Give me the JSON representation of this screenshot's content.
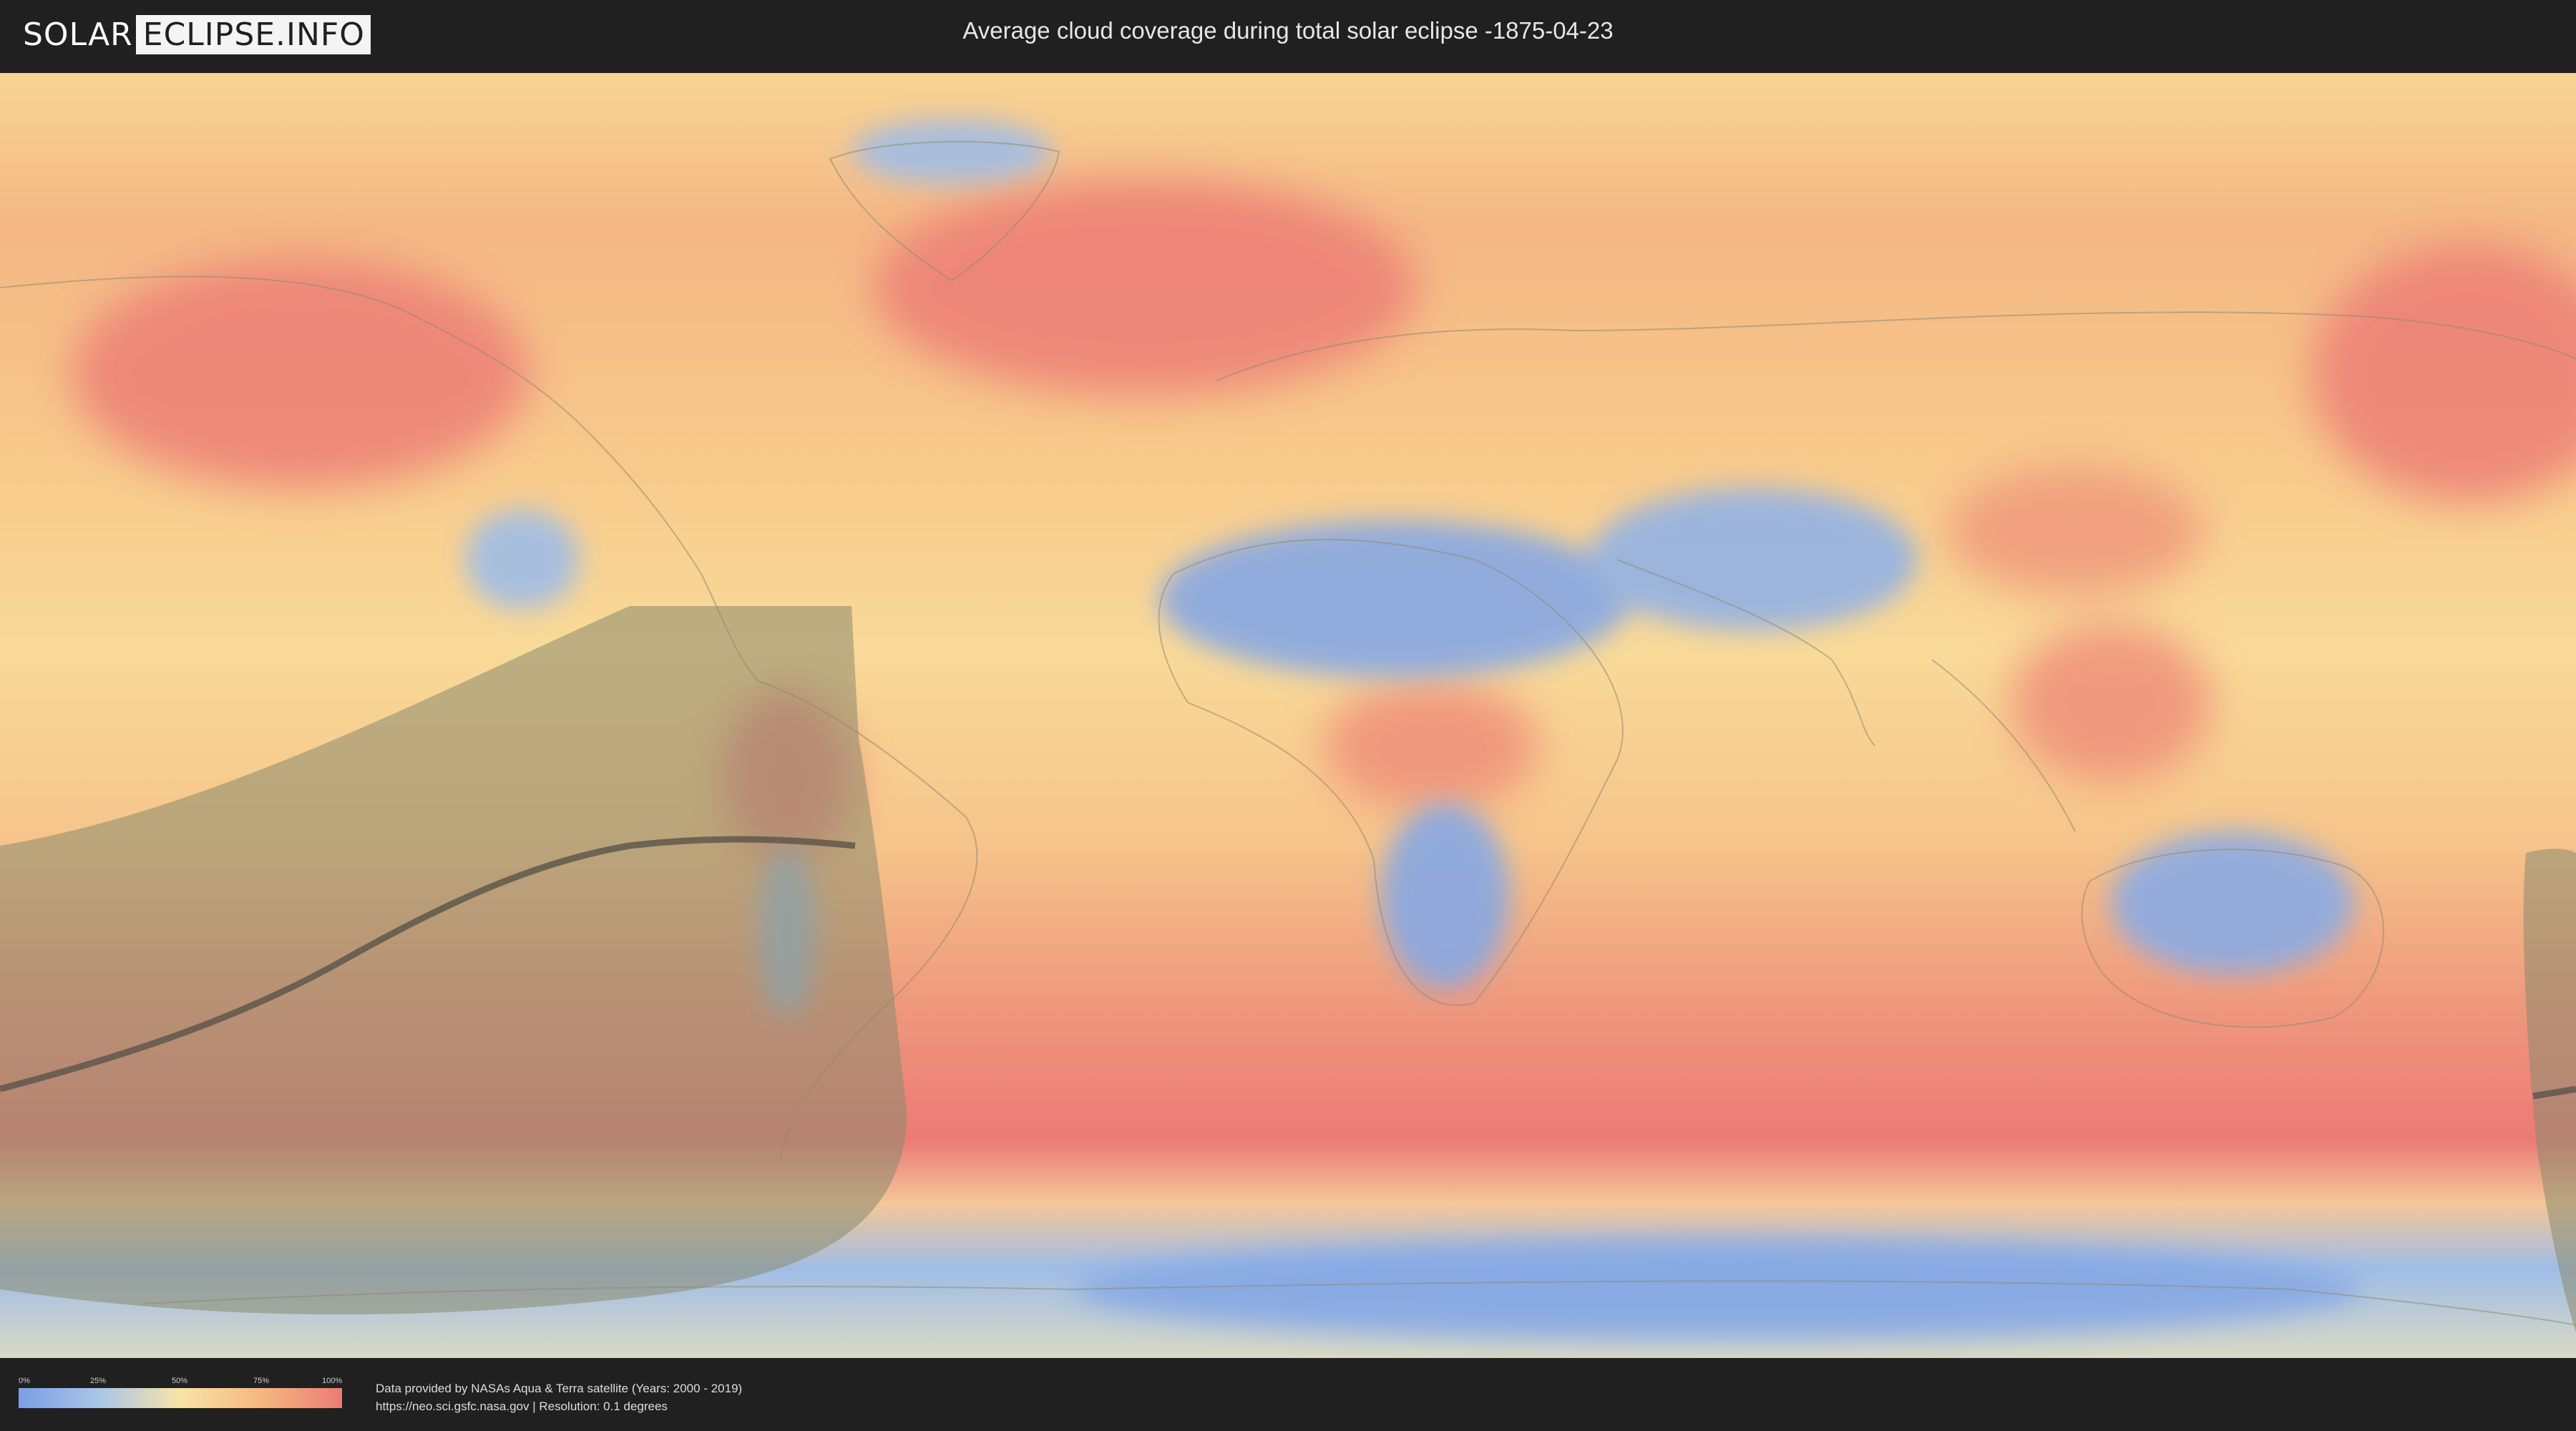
{
  "header": {
    "logo_solar": "SOLAR",
    "logo_eclipse": "ECLIPSE.INFO",
    "title": "Average cloud coverage during total solar eclipse -1875-04-23"
  },
  "legend": {
    "ticks": [
      "0%",
      "25%",
      "50%",
      "75%",
      "100%"
    ],
    "colors": [
      "#7a9fe6",
      "#a9c6e8",
      "#f8e3a6",
      "#f6b77e",
      "#ec7a76"
    ]
  },
  "credits": {
    "line1": "Data provided by NASAs Aqua & Terra satellite (Years: 2000 - 2019)",
    "line2": "https://neo.sci.gsfc.nasa.gov | Resolution: 0.1 degrees"
  },
  "map": {
    "projection": "equirectangular",
    "colors": {
      "ocean_mid": "#f8d08e",
      "cloudy": "#ec7a76",
      "clear": "#86a8e4",
      "eclipse_shadow": "#8a8a6e",
      "eclipse_path": "#5a5448"
    }
  }
}
